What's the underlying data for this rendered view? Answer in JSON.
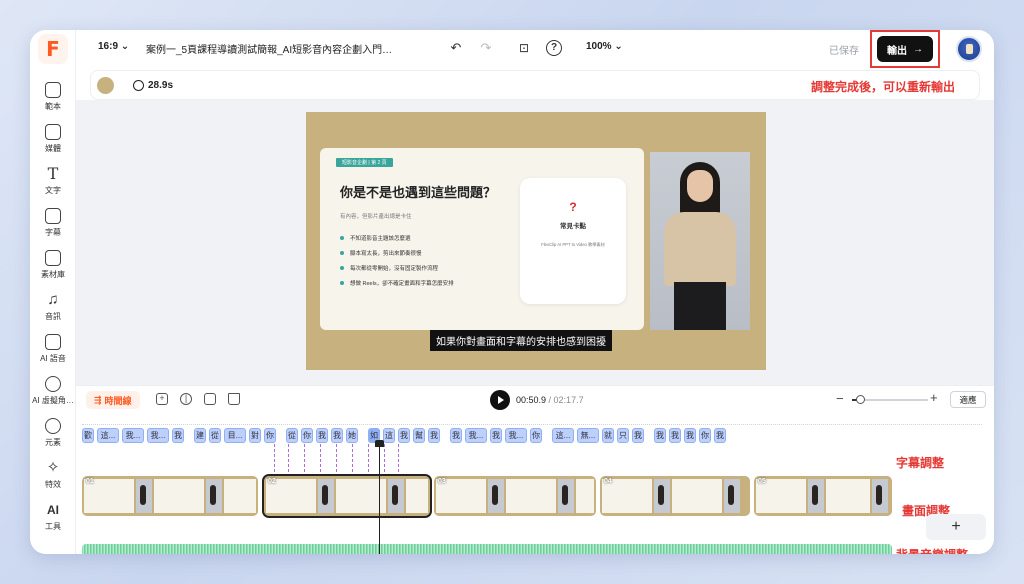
{
  "app": {
    "logo": "F"
  },
  "sidebar": {
    "items": [
      {
        "label": "範本",
        "icon": "template-icon"
      },
      {
        "label": "媒體",
        "icon": "media-upload-icon"
      },
      {
        "label": "文字",
        "icon": "text-icon"
      },
      {
        "label": "字幕",
        "icon": "subtitle-icon"
      },
      {
        "label": "素材庫",
        "icon": "asset-library-icon"
      },
      {
        "label": "音訊",
        "icon": "music-note-icon"
      },
      {
        "label": "AI 語音",
        "icon": "ai-voice-icon"
      },
      {
        "label": "AI 虛擬角…",
        "icon": "ai-avatar-icon"
      },
      {
        "label": "元素",
        "icon": "elements-icon"
      },
      {
        "label": "特效",
        "icon": "effects-icon"
      },
      {
        "label": "工具",
        "icon": "ai-tools-icon"
      }
    ]
  },
  "topbar": {
    "aspect_ratio": "16:9",
    "project_title": "案例一_5頁課程導讀測試簡報_AI短影音內容企劃入門…",
    "zoom": "100%",
    "saved_label": "已保存",
    "export_label": "輸出",
    "export_arrow": "→"
  },
  "subbar": {
    "bg_color": "#c7b27f",
    "duration": "28.9s",
    "annotation": "調整完成後，可以重新輸出"
  },
  "slide": {
    "tag": "短影音企劃 | 第 2 頁",
    "title": "你是不是也遇到這些問題？",
    "subtitle": "有內容，但影片產出總是卡住",
    "bullets": [
      "不知道影音主題該怎麼選",
      "腳本寫太長，剪出來節奏很慢",
      "每次都從零開始，沒有固定製作流程",
      "想做 Reels，卻不確定畫面和字幕怎麼安排"
    ],
    "faq_mark": "?",
    "faq_title": "常見卡點",
    "faq_note": "FlexClip AI PPT to Video 教學素材",
    "caption": "如果你對畫面和字幕的安排也感到困擾"
  },
  "timeline": {
    "tab_label": "時間線",
    "current_time": "00:50.9",
    "total_time": "/ 02:17.7",
    "zoom_level": 0.1,
    "fit_label": "適應",
    "subtitle_chips": [
      "歡",
      "這...",
      "我...",
      "我...",
      "我",
      "建",
      "從",
      "目...",
      "對",
      "你",
      "從",
      "你",
      "我",
      "我",
      "她",
      "如",
      "這",
      "我",
      "幫",
      "我",
      "我",
      "我...",
      "我",
      "我...",
      "你",
      "這...",
      "無...",
      "就",
      "只",
      "我",
      "我",
      "我",
      "我",
      "你",
      "我"
    ],
    "clips": [
      "01",
      "02",
      "03",
      "04",
      "05"
    ],
    "annot_subtitle": "字幕調整",
    "annot_scene": "畫面調整",
    "annot_audio": "背景音樂調整",
    "add_label": "+"
  }
}
